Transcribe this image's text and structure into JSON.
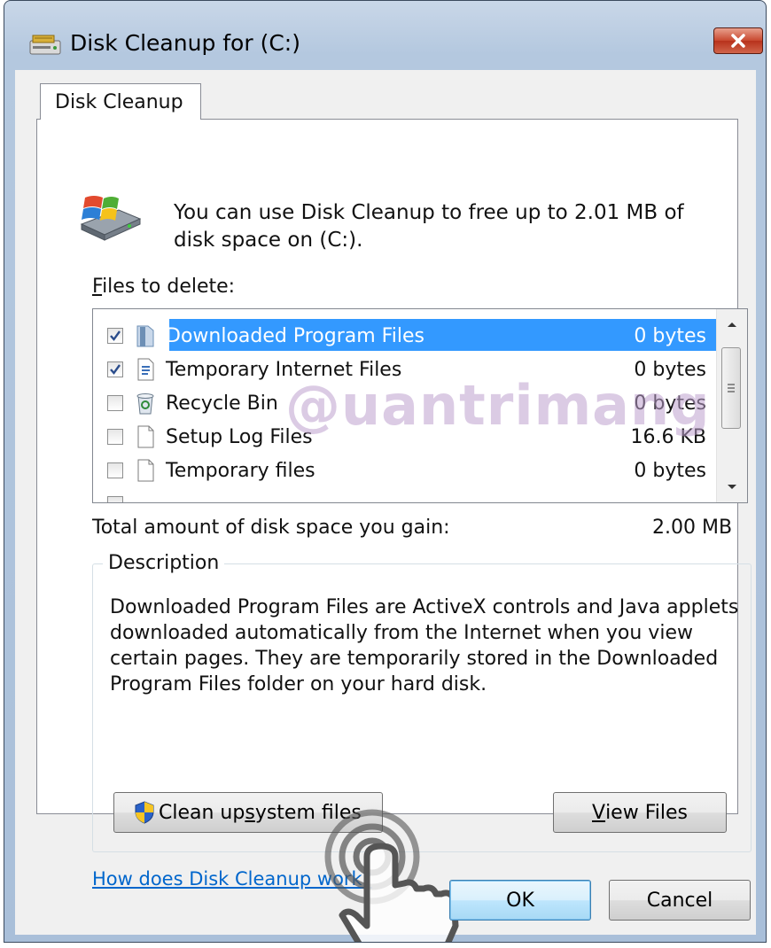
{
  "window": {
    "title": "Disk Cleanup for  (C:)"
  },
  "tab": {
    "label": "Disk Cleanup"
  },
  "intro": {
    "text": "You can use Disk Cleanup to free up to 2.01 MB of disk space on  (C:)."
  },
  "files_to_delete": {
    "label_accel": "F",
    "label_rest": "iles to delete:",
    "items": [
      {
        "name": "Downloaded Program Files",
        "size": "0 bytes",
        "checked": true,
        "selected": true,
        "icon": "folder-icon"
      },
      {
        "name": "Temporary Internet Files",
        "size": "0 bytes",
        "checked": true,
        "selected": false,
        "icon": "document-icon"
      },
      {
        "name": "Recycle Bin",
        "size": "0 bytes",
        "checked": false,
        "selected": false,
        "icon": "recycle-bin-icon"
      },
      {
        "name": "Setup Log Files",
        "size": "16.6 KB",
        "checked": false,
        "selected": false,
        "icon": "file-icon"
      },
      {
        "name": "Temporary files",
        "size": "0 bytes",
        "checked": false,
        "selected": false,
        "icon": "file-icon"
      }
    ]
  },
  "total": {
    "label": "Total amount of disk space you gain:",
    "value": "2.00 MB"
  },
  "description": {
    "title": "Description",
    "text": "Downloaded Program Files are ActiveX controls and Java applets downloaded automatically from the Internet when you view certain pages. They are temporarily stored in the Downloaded Program Files folder on your hard disk."
  },
  "buttons": {
    "cleanup_pre": "Clean up ",
    "cleanup_accel": "s",
    "cleanup_post": "ystem files",
    "view_accel": "V",
    "view_rest": "iew Files",
    "ok": "OK",
    "cancel": "Cancel"
  },
  "help_link": "How does Disk Cleanup work?",
  "watermark": "@uantrimang",
  "colors": {
    "selection": "#3399ff",
    "link": "#0066cc",
    "close_button": "#c8472e"
  }
}
